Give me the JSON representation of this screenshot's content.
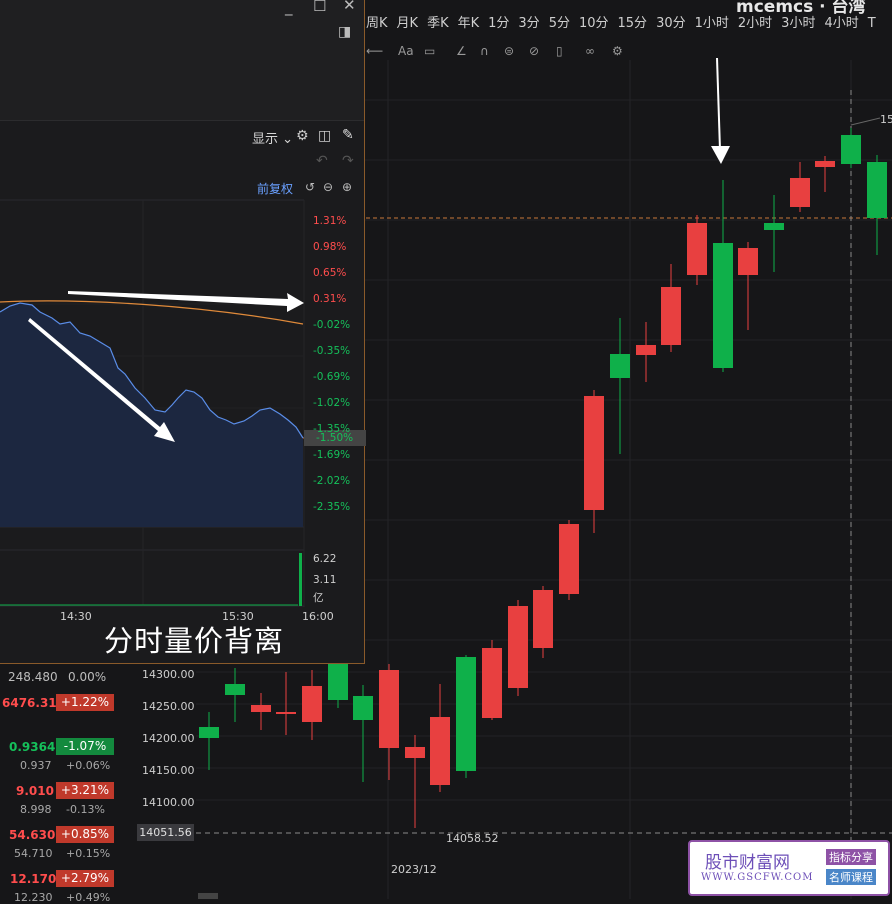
{
  "window_title": "mcemcs · 台湾",
  "periods": [
    "周K",
    "月K",
    "季K",
    "年K",
    "1分",
    "3分",
    "5分",
    "10分",
    "15分",
    "30分",
    "1小时",
    "2小时",
    "3小时",
    "4小时",
    "T"
  ],
  "minute_panel": {
    "display_label": "显示",
    "adjust_label": "前复权",
    "pct_labels": [
      "1.31%",
      "0.98%",
      "0.65%",
      "0.31%",
      "-0.02%",
      "-0.35%",
      "-0.69%",
      "-1.02%",
      "-1.35%",
      "-1.50%",
      "-1.69%",
      "-2.02%",
      "-2.35%"
    ],
    "volume_labels": [
      "6.22",
      "3.11",
      "亿"
    ],
    "time_labels": [
      "14:30",
      "15:30",
      "16:00"
    ],
    "caption": "分时量价背离"
  },
  "kline_axis": {
    "y_labels": [
      "14300.00",
      "14250.00",
      "14200.00",
      "14150.00",
      "14100.00"
    ],
    "current_price": "14051.56",
    "low_marker": "14058.52",
    "date_label": "2023/12",
    "top_right_label": "15"
  },
  "watchlist": [
    {
      "price": "248.480",
      "change": "0.00%",
      "price_color": "#bdbdbd"
    },
    {
      "price": "6476.31",
      "change": "+1.22%",
      "dir": "up"
    },
    {
      "price": "0.9364",
      "change": "-1.07%",
      "dir": "down",
      "sub_price": "0.937",
      "sub_change": "+0.06%"
    },
    {
      "price": "9.010",
      "change": "+3.21%",
      "dir": "up",
      "sub_price": "8.998",
      "sub_change": "-0.13%"
    },
    {
      "price": "54.630",
      "change": "+0.85%",
      "dir": "up",
      "sub_price": "54.710",
      "sub_change": "+0.15%"
    },
    {
      "price": "12.170",
      "change": "+2.79%",
      "dir": "up",
      "sub_price": "12.230",
      "sub_change": "+0.49%"
    }
  ],
  "watermark": {
    "title": "股市财富网",
    "url": "WWW.GSCFW.COM",
    "tag1": "指标分享",
    "tag2": "名师课程"
  },
  "colors": {
    "up": "#e84040",
    "down": "#0fb04a",
    "bg": "#161618",
    "accent": "#6aa0ff"
  }
}
